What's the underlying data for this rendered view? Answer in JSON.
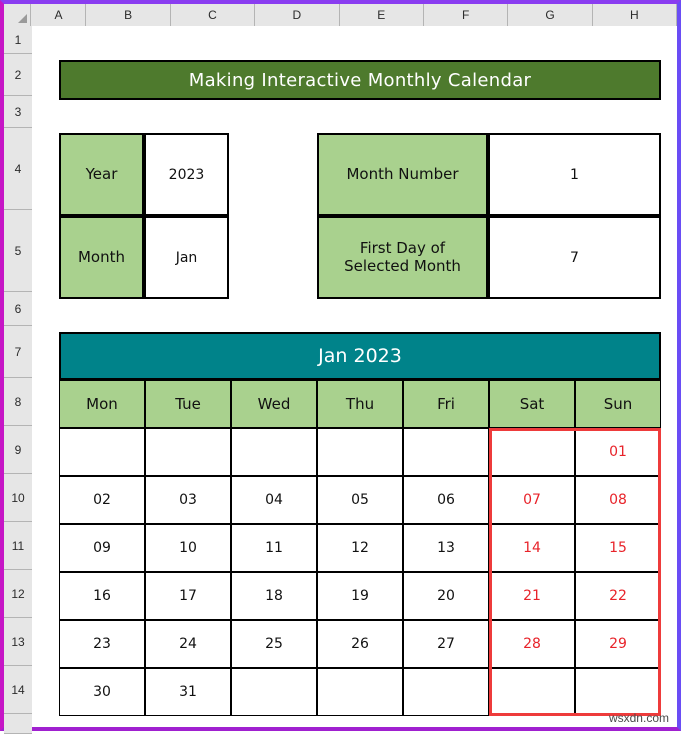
{
  "spreadsheet": {
    "column_headers": [
      "A",
      "B",
      "C",
      "D",
      "E",
      "F",
      "G",
      "H"
    ],
    "row_headers": [
      "1",
      "2",
      "3",
      "4",
      "5",
      "6",
      "7",
      "8",
      "9",
      "10",
      "11",
      "12",
      "13",
      "14"
    ],
    "watermark": "wsxdn.com"
  },
  "title_banner": {
    "text": "Making Interactive Monthly Calendar",
    "background": "#4e7a2d",
    "text_color": "#ffffff"
  },
  "inputs_left": {
    "rows": [
      {
        "label": "Year",
        "value": "2023"
      },
      {
        "label": "Month",
        "value": "Jan"
      }
    ]
  },
  "inputs_right": {
    "rows": [
      {
        "label": "Month Number",
        "value": "1"
      },
      {
        "label": "First Day of Selected Month",
        "value": "7"
      }
    ]
  },
  "calendar": {
    "header": "Jan 2023",
    "header_background": "#00838a",
    "weekday_background": "#a9d18e",
    "weekend_color": "#e8232a",
    "weekday_labels": [
      "Mon",
      "Tue",
      "Wed",
      "Thu",
      "Fri",
      "Sat",
      "Sun"
    ],
    "weekend_columns": [
      5,
      6
    ],
    "weeks": [
      [
        "",
        "",
        "",
        "",
        "",
        "",
        "01"
      ],
      [
        "02",
        "03",
        "04",
        "05",
        "06",
        "07",
        "08"
      ],
      [
        "09",
        "10",
        "11",
        "12",
        "13",
        "14",
        "15"
      ],
      [
        "16",
        "17",
        "18",
        "19",
        "20",
        "21",
        "22"
      ],
      [
        "23",
        "24",
        "25",
        "26",
        "27",
        "28",
        "29"
      ],
      [
        "30",
        "31",
        "",
        "",
        "",
        "",
        ""
      ]
    ]
  }
}
